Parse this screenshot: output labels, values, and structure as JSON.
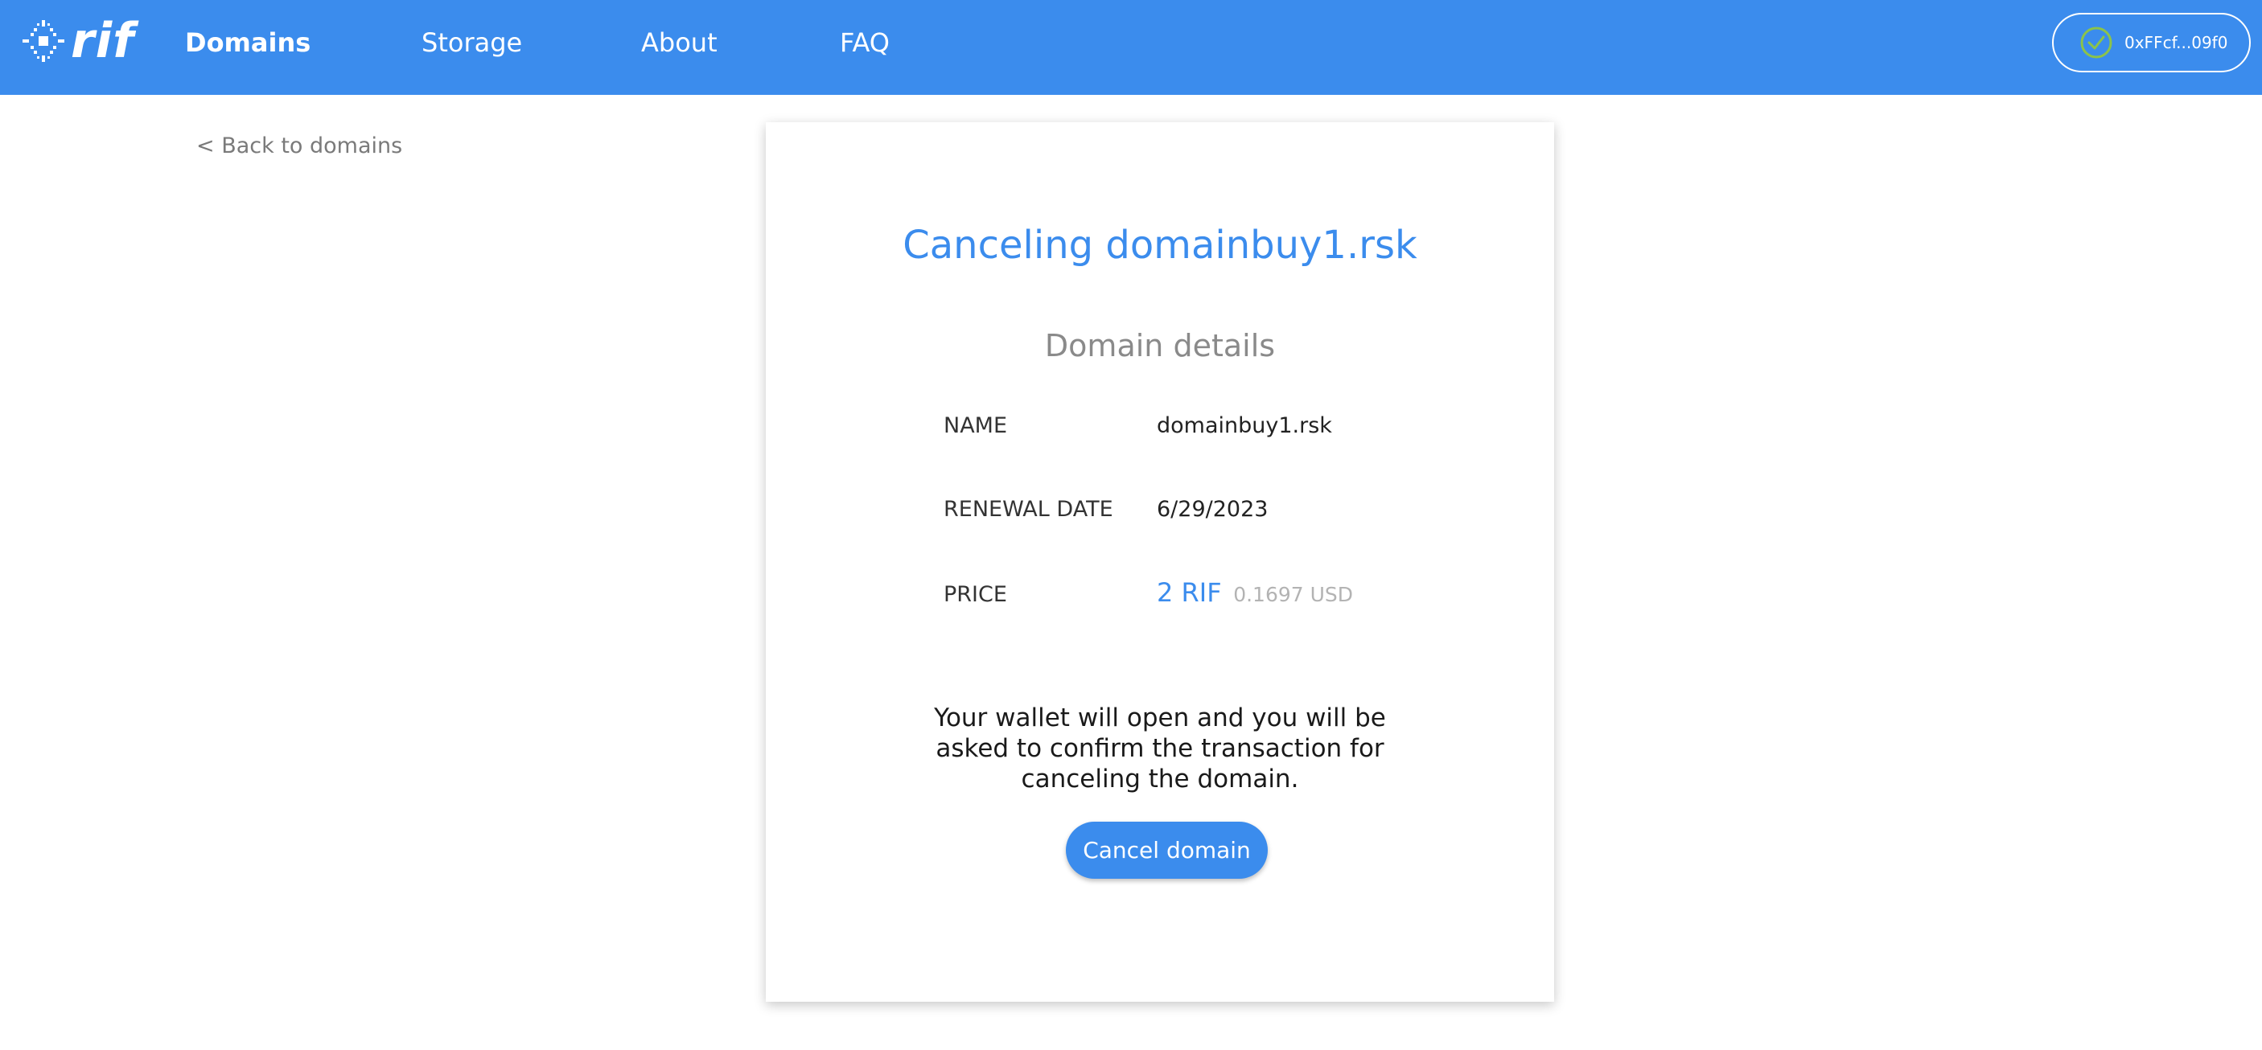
{
  "header": {
    "logo_text": "rif",
    "logo_icon": "rif-logo-icon",
    "nav": [
      {
        "label": "Domains",
        "active": true
      },
      {
        "label": "Storage",
        "active": false
      },
      {
        "label": "About",
        "active": false
      },
      {
        "label": "FAQ",
        "active": false
      }
    ],
    "wallet": {
      "address": "0xFFcf...09f0",
      "status_icon": "check-circle-icon",
      "status_color": "#8bc34a"
    },
    "background": "#3b8ced"
  },
  "back_link": "< Back to domains",
  "card": {
    "title": "Canceling domainbuy1.rsk",
    "section_title": "Domain details",
    "details": [
      {
        "label": "NAME",
        "value": "domainbuy1.rsk"
      },
      {
        "label": "RENEWAL DATE",
        "value": "6/29/2023"
      },
      {
        "label": "PRICE",
        "value": "2 RIF",
        "secondary": "0.1697 USD"
      }
    ],
    "notice": "Your wallet will open and you will be asked to confirm the transaction for canceling the domain.",
    "cancel_button": "Cancel domain"
  },
  "colors": {
    "accent": "#3b8ced",
    "muted": "#8a8a8a"
  }
}
